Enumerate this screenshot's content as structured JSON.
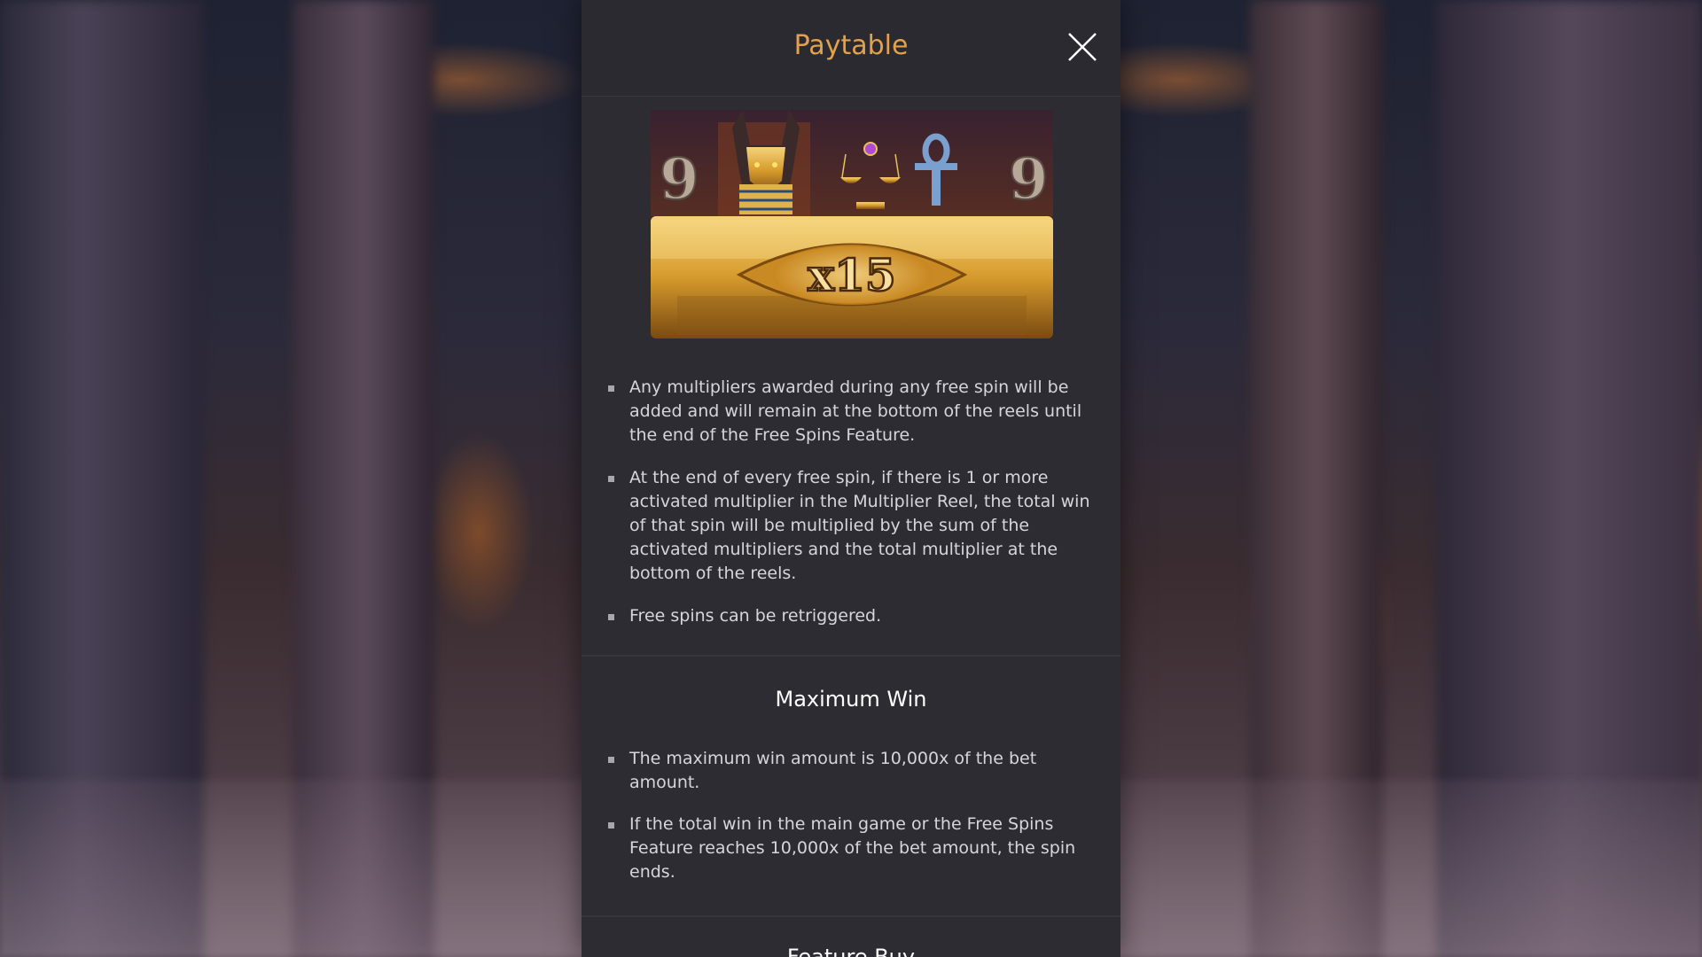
{
  "dialog": {
    "title": "Paytable",
    "close_icon": "close-icon"
  },
  "feature_image": {
    "symbols": [
      "9",
      "anubis",
      "scales",
      "ankh",
      "9"
    ],
    "multiplier_label": "x15"
  },
  "free_spins_rules": [
    "Any multipliers awarded during any free spin will be added and will remain at the bottom of the reels until the end of the Free Spins Feature.",
    "At the end of every free spin, if there is 1 or more activated multiplier in the Multiplier Reel, the total win of that spin will be multiplied by the sum of the activated multipliers and the total multiplier at the bottom of the reels.",
    "Free spins can be retriggered."
  ],
  "maximum_win": {
    "title": "Maximum Win",
    "rules": [
      "The maximum win amount is 10,000x of the bet amount.",
      "If the total win in the main game or the Free Spins Feature reaches 10,000x of the bet amount, the spin ends."
    ]
  },
  "next_section": {
    "title": "Feature Buy"
  },
  "colors": {
    "title_gold": "#e3a24a",
    "panel_bg": "#2d2c33",
    "text": "#d7d5dc"
  }
}
